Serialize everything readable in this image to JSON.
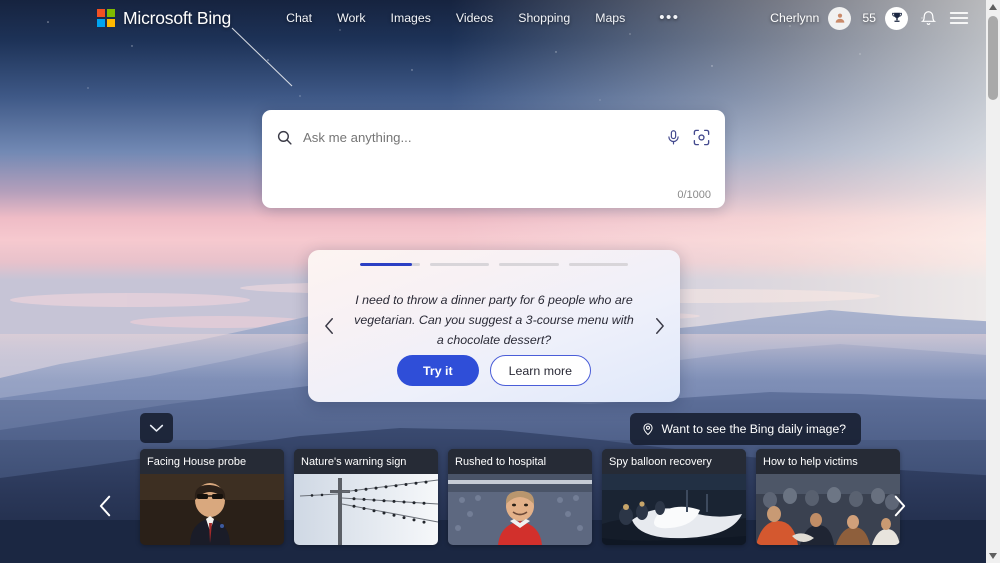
{
  "header": {
    "brand": "Microsoft Bing",
    "nav": [
      {
        "label": "Chat"
      },
      {
        "label": "Work"
      },
      {
        "label": "Images"
      },
      {
        "label": "Videos"
      },
      {
        "label": "Shopping"
      },
      {
        "label": "Maps"
      }
    ],
    "more_label": "•••",
    "username": "Cherlynn",
    "points": "55"
  },
  "search": {
    "placeholder": "Ask me anything...",
    "value": "",
    "charcount": "0/1000"
  },
  "suggestion": {
    "text": "I need to throw a dinner party for 6 people who are vegetarian. Can you suggest a 3-course menu with a chocolate dessert?",
    "try_label": "Try it",
    "learn_label": "Learn more",
    "progress": [
      100,
      0,
      0,
      0
    ],
    "active_index": 0
  },
  "daily_image": {
    "label": "Want to see the Bing daily image?"
  },
  "news": {
    "cards": [
      {
        "title": "Facing House probe"
      },
      {
        "title": "Nature's warning sign"
      },
      {
        "title": "Rushed to hospital"
      },
      {
        "title": "Spy balloon recovery"
      },
      {
        "title": "How to help victims"
      }
    ]
  },
  "colors": {
    "accent_blue": "#2f4ed8",
    "progress_active": "#2b3fc4",
    "logo_red": "#f25022",
    "logo_green": "#7fba00",
    "logo_blue": "#00a4ef",
    "logo_yellow": "#ffb900",
    "overlay_dark": "#101626"
  }
}
